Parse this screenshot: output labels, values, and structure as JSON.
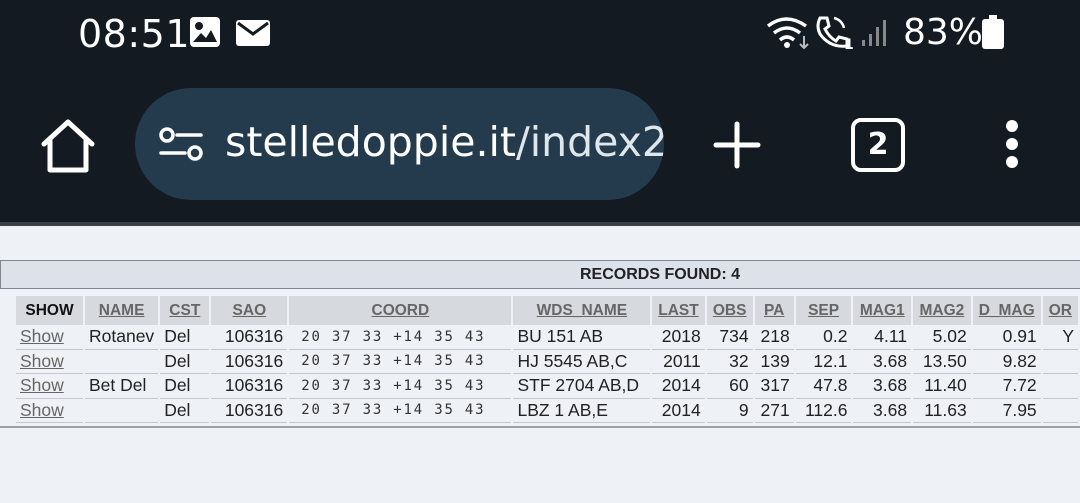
{
  "status_bar": {
    "time": "08:51",
    "battery": "83%",
    "icons": [
      "image-icon",
      "mail-icon",
      "wifi-icon",
      "wifi-call-icon",
      "signal-icon",
      "battery-icon"
    ]
  },
  "browser": {
    "url_host": "stelledoppie.it",
    "url_path": "/index2",
    "tab_count": "2"
  },
  "results": {
    "records_found": "RECORDS FOUND: 4",
    "columns": [
      "SHOW",
      "NAME",
      "CST",
      "SAO",
      "COORD",
      "WDS_NAME",
      "LAST",
      "OBS",
      "PA",
      "SEP",
      "MAG1",
      "MAG2",
      "D_MAG",
      "OR"
    ],
    "rows": [
      {
        "show": "Show",
        "name": "Rotanev",
        "cst": "Del",
        "sao": "106316",
        "coord": "20 37 33 +14 35 43",
        "wds_name": "BU 151 AB",
        "last": "2018",
        "obs": "734",
        "pa": "218",
        "sep": "0.2",
        "mag1": "4.11",
        "mag2": "5.02",
        "d_mag": "0.91",
        "or": "Y"
      },
      {
        "show": "Show",
        "name": "",
        "cst": "Del",
        "sao": "106316",
        "coord": "20 37 33 +14 35 43",
        "wds_name": "HJ 5545 AB,C",
        "last": "2011",
        "obs": "32",
        "pa": "139",
        "sep": "12.1",
        "mag1": "3.68",
        "mag2": "13.50",
        "d_mag": "9.82",
        "or": ""
      },
      {
        "show": "Show",
        "name": "Bet Del",
        "cst": "Del",
        "sao": "106316",
        "coord": "20 37 33 +14 35 43",
        "wds_name": "STF 2704 AB,D",
        "last": "2014",
        "obs": "60",
        "pa": "317",
        "sep": "47.8",
        "mag1": "3.68",
        "mag2": "11.40",
        "d_mag": "7.72",
        "or": ""
      },
      {
        "show": "Show",
        "name": "",
        "cst": "Del",
        "sao": "106316",
        "coord": "20 37 33 +14 35 43",
        "wds_name": "LBZ 1 AB,E",
        "last": "2014",
        "obs": "9",
        "pa": "271",
        "sep": "112.6",
        "mag1": "3.68",
        "mag2": "11.63",
        "d_mag": "7.95",
        "or": ""
      }
    ]
  }
}
